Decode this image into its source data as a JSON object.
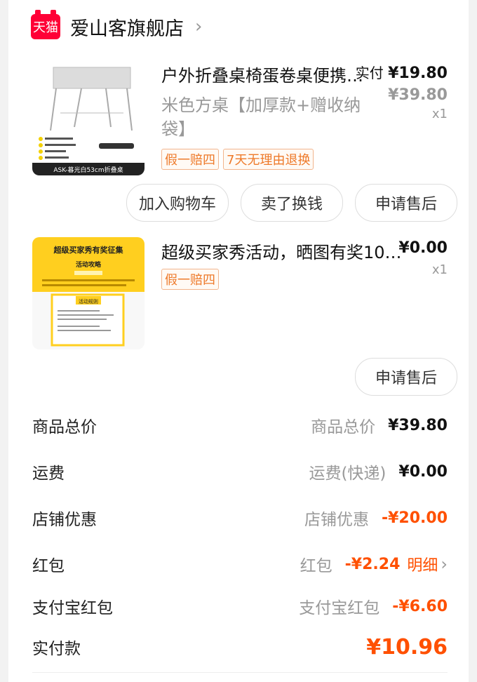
{
  "shop": {
    "badge": "天猫",
    "name": "爱山客旗舰店"
  },
  "item1": {
    "title": "户外折叠桌椅蛋卷桌便携…",
    "sku": "米色方桌【加厚款+赠收纳袋】",
    "paid_label": "实付",
    "paid_price": "¥19.80",
    "orig_price": "¥39.80",
    "qty": "x1",
    "tags": [
      "假一赔四",
      "7天无理由退换"
    ],
    "buttons": [
      "加入购物车",
      "卖了换钱",
      "申请售后"
    ],
    "image_text": [
      "ASK-暮光白53cm折叠桌",
      "比同款加高5CM",
      "比同款桌面加大约10%",
      "碳钢合金材质",
      "加大防滑脚套"
    ]
  },
  "item2": {
    "title": "超级买家秀活动，晒图有奖10…",
    "price": "¥0.00",
    "qty": "x1",
    "tags": [
      "假一赔四"
    ],
    "button": "申请售后",
    "image_text": [
      "超级买家秀有奖征集",
      "活动攻略",
      "活动规则"
    ]
  },
  "summary": {
    "rows": [
      {
        "label": "商品总价",
        "sub": "商品总价",
        "value": "¥39.80"
      },
      {
        "label": "运费",
        "sub": "运费(快递)",
        "value": "¥0.00"
      },
      {
        "label": "店铺优惠",
        "sub": "店铺优惠",
        "value": "-¥20.00"
      },
      {
        "label": "红包",
        "sub": "红包",
        "value": "-¥2.24",
        "link": "明细"
      },
      {
        "label": "支付宝红包",
        "sub": "支付宝红包",
        "value": "-¥6.60"
      }
    ],
    "total_label": "实付款",
    "total_value": "¥10.96"
  },
  "colors": {
    "brand": "#ff0036",
    "accent": "#ff5000",
    "tag": "#ee7a2a"
  }
}
